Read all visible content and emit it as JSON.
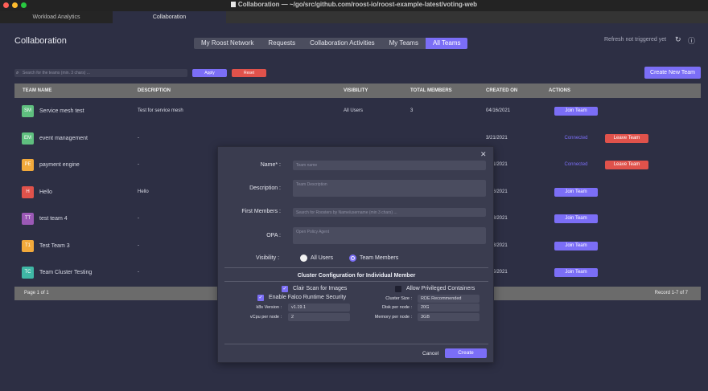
{
  "window": {
    "title": "Collaboration — ~/go/src/github.com/roost-io/roost-example-latest/voting-web",
    "tabs": [
      "Workload Analytics",
      "Collaboration"
    ]
  },
  "colors": {
    "accent": "#7b6ef6",
    "danger": "#e0524b",
    "background": "#2d2f44"
  },
  "page": {
    "title": "Collaboration",
    "subnav": [
      "My Roost Network",
      "Requests",
      "Collaboration Activities",
      "My Teams",
      "All Teams"
    ],
    "active_subnav": "All Teams",
    "refresh_text": "Refresh not triggered yet"
  },
  "toolbar": {
    "search_placeholder": "Search for the teams (min. 3 chars) ...",
    "apply_label": "Apply",
    "reset_label": "Reset",
    "create_label": "Create New Team"
  },
  "table": {
    "columns": [
      "TEAM NAME",
      "DESCRIPTION",
      "VISIBILITY",
      "TOTAL MEMBERS",
      "CREATED ON",
      "ACTIONS"
    ],
    "rows": [
      {
        "initials": "SM",
        "color": "#5fbf7f",
        "name": "Service mesh test",
        "description": "Test for service mesh",
        "visibility": "All Users",
        "members": "3",
        "created": "04/16/2021",
        "action": "Join Team",
        "leave": ""
      },
      {
        "initials": "EM",
        "color": "#5fbf7f",
        "name": "event management",
        "description": "-",
        "visibility": "",
        "members": "",
        "created": "3/21/2021",
        "action": "Connected",
        "leave": "Leave Team"
      },
      {
        "initials": "PE",
        "color": "#f2a93b",
        "name": "payment engine",
        "description": "-",
        "visibility": "",
        "members": "",
        "created": "3/21/2021",
        "action": "Connected",
        "leave": "Leave Team"
      },
      {
        "initials": "H",
        "color": "#e0524b",
        "name": "Hello",
        "description": "Hello",
        "visibility": "",
        "members": "",
        "created": "2/26/2021",
        "action": "Join Team",
        "leave": ""
      },
      {
        "initials": "TT",
        "color": "#9b59b6",
        "name": "test team 4",
        "description": "-",
        "visibility": "",
        "members": "",
        "created": "2/18/2021",
        "action": "Join Team",
        "leave": ""
      },
      {
        "initials": "T1",
        "color": "#f2a93b",
        "name": "Test Team 3",
        "description": "-",
        "visibility": "",
        "members": "",
        "created": "2/18/2021",
        "action": "Join Team",
        "leave": ""
      },
      {
        "initials": "TC",
        "color": "#3fb7a5",
        "name": "Team Cluster Testing",
        "description": "-",
        "visibility": "",
        "members": "",
        "created": "2/15/2021",
        "action": "Join Team",
        "leave": ""
      }
    ],
    "footer_left": "Page 1 of 1",
    "footer_right": "Record 1-7 of 7"
  },
  "modal": {
    "name_label": "Name* :",
    "name_placeholder": "Team name",
    "description_label": "Description :",
    "description_placeholder": "Team Description",
    "members_label": "First Members :",
    "members_placeholder": "Search for Roosters by Name/username (min 3 chars) ...",
    "opa_label": "OPA :",
    "opa_placeholder": "Open Policy Agent",
    "visibility_label": "Visibility :",
    "visibility_options": [
      "All Users",
      "Team Members"
    ],
    "visibility_selected": "Team Members",
    "cluster_title": "Cluster Configuration for Individual Member",
    "clair_label": "Clair Scan for Images",
    "clair_checked": true,
    "falco_label": "Enable Falco Runtime Security",
    "falco_checked": true,
    "privileged_label": "Allow Privileged Containers",
    "privileged_checked": false,
    "k8s_label": "k8s Version :",
    "k8s_value": "v1.19.1",
    "vcpu_label": "vCpu per node :",
    "vcpu_value": "2",
    "cluster_size_label": "Cluster Size :",
    "cluster_size_value": "RDE Recommended",
    "disk_label": "Disk per node :",
    "disk_value": "20G",
    "memory_label": "Memory per node :",
    "memory_value": "3GB",
    "cancel_label": "Cancel",
    "create_label": "Create"
  }
}
